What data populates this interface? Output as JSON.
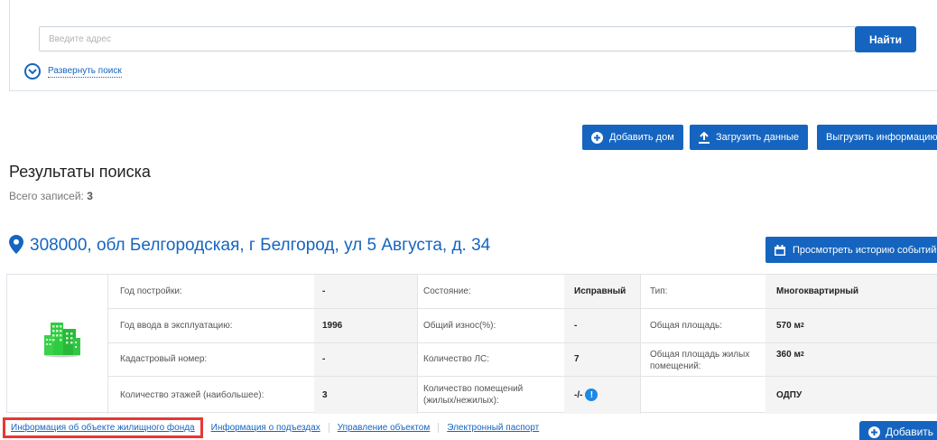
{
  "search": {
    "placeholder": "Введите адрес",
    "value": "",
    "find_label": "Найти",
    "expand_label": "Развернуть поиск"
  },
  "actions": {
    "add_house": "Добавить дом",
    "upload_data": "Загрузить данные",
    "export_info": "Выгрузить информацию"
  },
  "results": {
    "title": "Результаты поиска",
    "count_label": "Всего записей:",
    "count_value": "3"
  },
  "house": {
    "address": "308000, обл Белгородская, г Белгород, ул 5 Августа, д. 34",
    "history_label": "Просмотреть историю событий",
    "fields": {
      "year_built_label": "Год постройки:",
      "year_built_value": "-",
      "year_commissioned_label": "Год ввода в эксплуатацию:",
      "year_commissioned_value": "1996",
      "cadastral_label": "Кадастровый номер:",
      "cadastral_value": "-",
      "floors_label": "Количество этажей (наибольшее):",
      "floors_value": "3",
      "condition_label": "Состояние:",
      "condition_value": "Исправный",
      "wear_label": "Общий износ(%):",
      "wear_value": "-",
      "accounts_label": "Количество ЛС:",
      "accounts_value": "7",
      "premises_label": "Количество помещений (жилых/нежилых):",
      "premises_value": "-/-",
      "type_label": "Тип:",
      "type_value": "Многоквартирный",
      "total_area_label": "Общая площадь:",
      "total_area_value": "570 м",
      "living_area_label": "Общая площадь жилых помещений:",
      "living_area_value": "360 м",
      "area_unit_sup": "2",
      "odpu_label": "ОДПУ"
    }
  },
  "tabs": [
    {
      "label": "Информация об объекте жилищного фонда"
    },
    {
      "label": "Информация о подъездах"
    },
    {
      "label": "Управление объектом"
    },
    {
      "label": "Электронный паспорт"
    }
  ],
  "add_label": "Добавить",
  "colors": {
    "accent": "#1565c0",
    "highlight": "#e53935",
    "building": "#2ecc40"
  }
}
